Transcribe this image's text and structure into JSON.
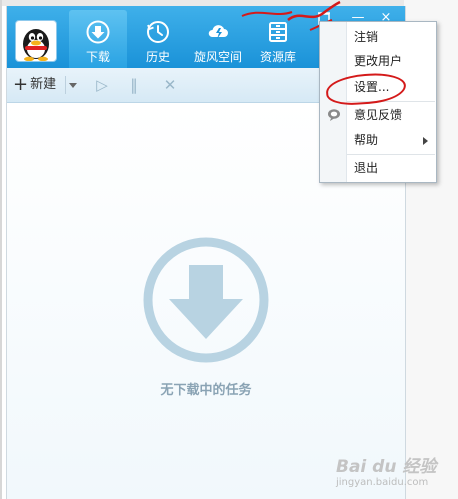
{
  "app": {
    "nav_tabs": [
      {
        "label": "下载",
        "icon": "download-icon"
      },
      {
        "label": "历史",
        "icon": "history-icon"
      },
      {
        "label": "旋风空间",
        "icon": "cloud-space-icon"
      },
      {
        "label": "资源库",
        "icon": "library-icon"
      }
    ],
    "window_controls": {
      "minimize": "—",
      "close": "×"
    }
  },
  "toolbar": {
    "new_label": "新建",
    "play": "▷",
    "pause": "‖",
    "delete": "✕"
  },
  "content": {
    "empty_message": "无下载中的任务"
  },
  "menu": {
    "items": [
      {
        "label": "注销"
      },
      {
        "label": "更改用户"
      },
      {
        "label": "设置..."
      },
      {
        "label": "意见反馈",
        "icon": "feedback-icon"
      },
      {
        "label": "帮助",
        "submenu": true
      },
      {
        "label": "退出"
      }
    ]
  },
  "watermark": {
    "brand": "Bai du 经验",
    "url": "jingyan.baidu.com"
  },
  "colors": {
    "titlebar": "#1a92d8",
    "annotation": "#d41a1a",
    "empty_icon": "#b8d3e2"
  }
}
